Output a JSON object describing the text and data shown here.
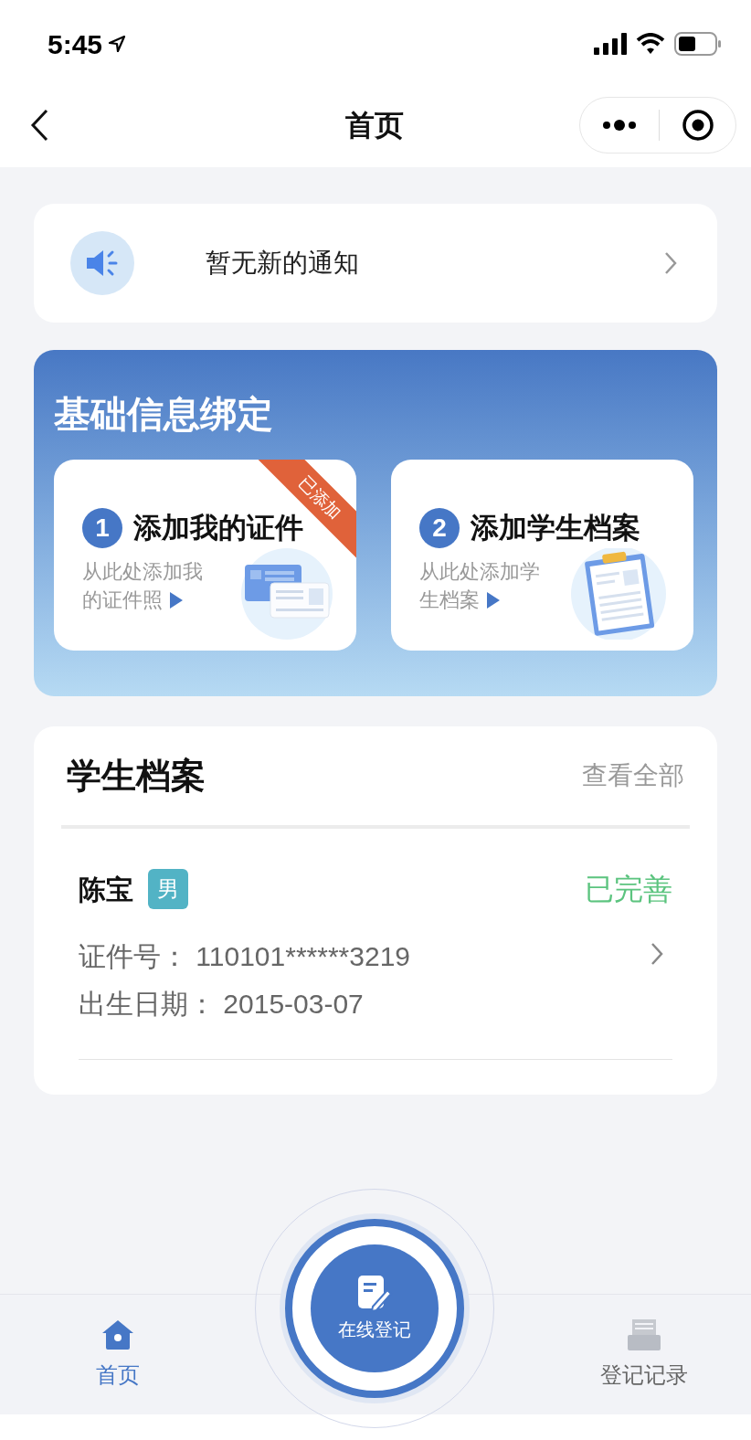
{
  "status_bar": {
    "time": "5:45"
  },
  "nav": {
    "title": "首页"
  },
  "notice": {
    "text": "暂无新的通知"
  },
  "binding": {
    "title": "基础信息绑定",
    "steps": [
      {
        "number": "1",
        "title": "添加我的证件",
        "description": "从此处添加我的证件照",
        "kind": "card",
        "added": true,
        "badge": "已添加"
      },
      {
        "number": "2",
        "title": "添加学生档案",
        "description": "从此处添加学生档案",
        "kind": "clipboard",
        "added": false
      }
    ]
  },
  "students": {
    "title": "学生档案",
    "view_all": "查看全部",
    "items": [
      {
        "name": "陈宝",
        "gender": "男",
        "status": "已完善",
        "id_line": "证件号： 110101******3219",
        "birth_line": "出生日期： 2015-03-07"
      }
    ]
  },
  "center_action": {
    "label": "在线登记"
  },
  "tabs": [
    {
      "label": "首页",
      "kind": "home",
      "selected": true
    },
    {
      "label": "登记记录",
      "kind": "records",
      "selected": false
    }
  ]
}
